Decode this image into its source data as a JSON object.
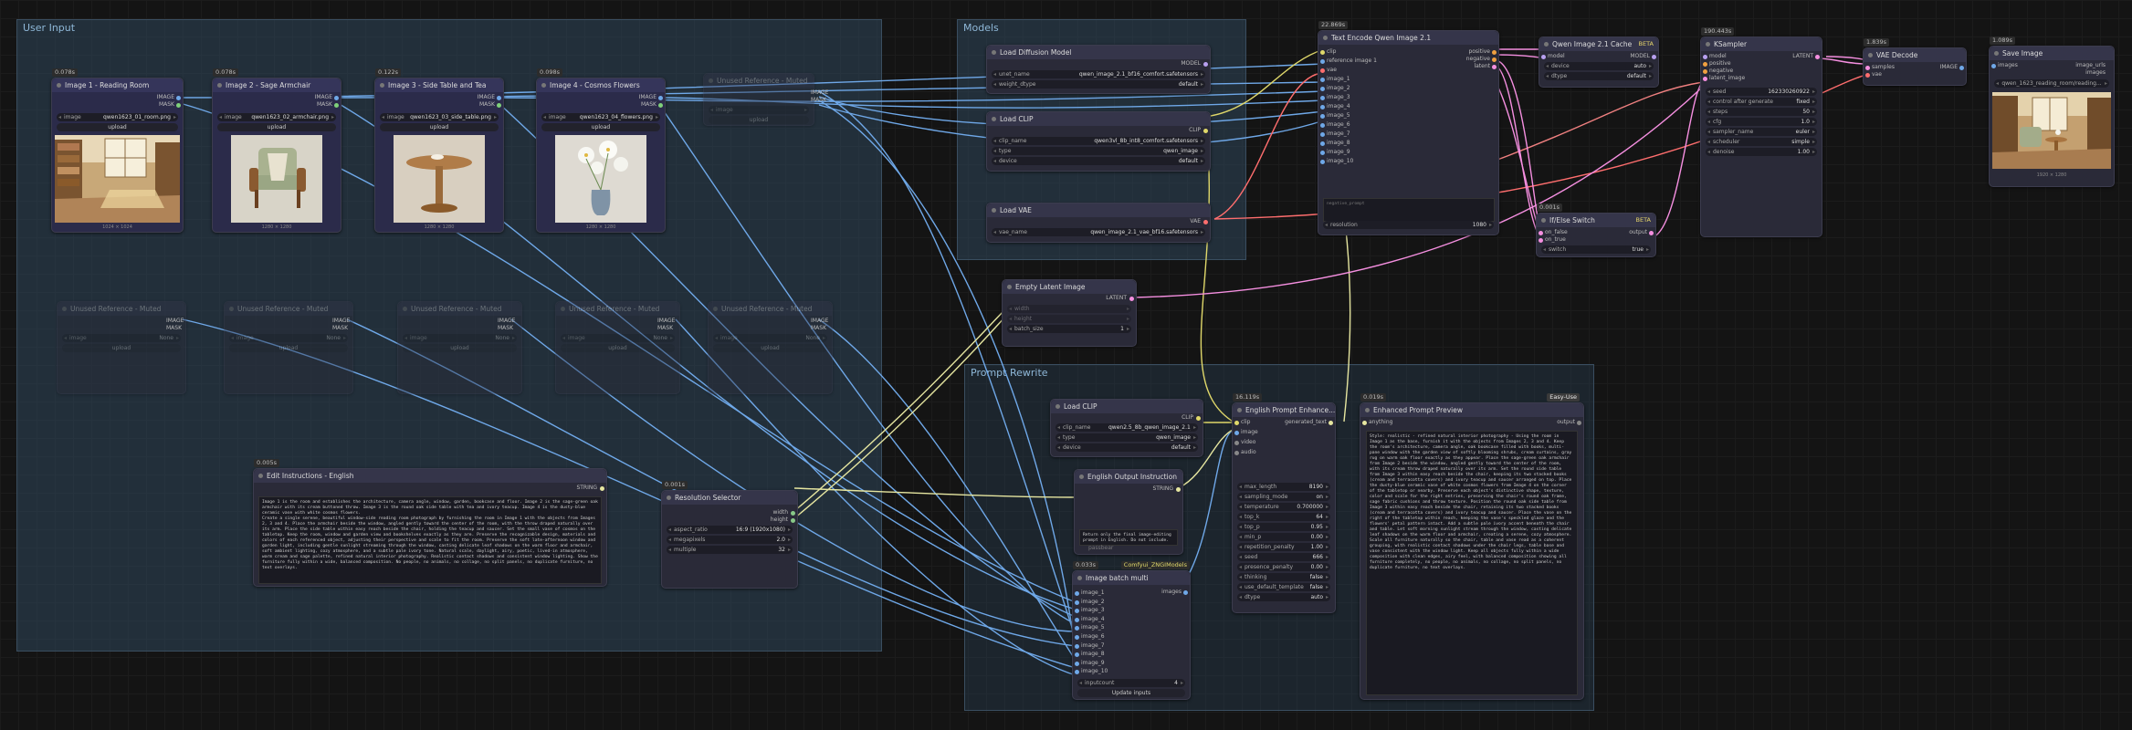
{
  "groups": {
    "user_input": "User Input",
    "models": "Models",
    "prompt_rewrite": "Prompt Rewrite"
  },
  "badges": {
    "img1": "0.078s",
    "img2": "0.078s",
    "img3": "0.122s",
    "img4": "0.098s",
    "edit": "0.005s",
    "res": "0.001s",
    "text_encode": "22.869s",
    "qwen_cache": "BETA",
    "ksampler": "190.443s",
    "vae_decode": "1.839s",
    "save": "1.089s",
    "if_else": "0.001s",
    "batch": "0.033s",
    "batch_tag": "Comfyui_ZNGIModels",
    "enhance": "16.119s",
    "preview": "0.019s",
    "preview_tag": "Easy-Use"
  },
  "image_nodes": [
    {
      "title": "Image 1 - Reading Room",
      "file": "qwen1623_01_room.png",
      "caption": "1024 × 1024"
    },
    {
      "title": "Image 2 - Sage Armchair",
      "file": "qwen1623_02_armchair.png",
      "caption": "1280 × 1280"
    },
    {
      "title": "Image 3 - Side Table and Tea",
      "file": "qwen1623_03_side_table.png",
      "caption": "1280 × 1280"
    },
    {
      "title": "Image 4 - Cosmos Flowers",
      "file": "qwen1623_04_flowers.png",
      "caption": "1280 × 1280"
    }
  ],
  "muted_nodes": [
    "Unused Reference - Muted",
    "Unused Reference - Muted",
    "Unused Reference - Muted",
    "Unused Reference - Muted",
    "Unused Reference - Muted",
    "Unused Reference - Muted"
  ],
  "labels": {
    "image": "IMAGE",
    "mask": "MASK",
    "image_w": "image",
    "upload": "upload",
    "none": "None"
  },
  "load_diffusion": {
    "title": "Load Diffusion Model",
    "out": "MODEL",
    "unet_name_k": "unet_name",
    "unet_name_v": "qwen_image_2.1_bf16_comfort.safetensors",
    "weight_dtype_k": "weight_dtype",
    "weight_dtype_v": "default"
  },
  "load_clip": {
    "title": "Load CLIP",
    "out": "CLIP",
    "clip_name_k": "clip_name",
    "clip_name_v": "qwen3vl_8b_int8_comfort.safetensors",
    "type_k": "type",
    "type_v": "qwen_image",
    "device_k": "device",
    "device_v": "default"
  },
  "load_vae": {
    "title": "Load VAE",
    "out": "VAE",
    "vae_name_k": "vae_name",
    "vae_name_v": "qwen_image_2.1_vae_bf16.safetensors"
  },
  "empty_latent": {
    "title": "Empty Latent Image",
    "out": "LATENT",
    "width": "width",
    "height": "height",
    "batch_k": "batch_size",
    "batch_v": "1"
  },
  "text_encode": {
    "title": "Text Encode Qwen Image 2.1",
    "inputs": [
      "clip",
      "reference image 1",
      "vae",
      "image_1",
      "image_2",
      "image_3",
      "image_4",
      "image_5",
      "image_6",
      "image_7",
      "image_8",
      "image_9",
      "image_10"
    ],
    "prompt_placeholder": "negative_prompt",
    "res_k": "resolution",
    "res_v": "1080",
    "outs": [
      "positive",
      "negative",
      "latent"
    ]
  },
  "qwen_cache": {
    "title": "Qwen Image 2.1 Cache",
    "in_model": "model",
    "out_model": "MODEL",
    "device_k": "device",
    "device_v": "auto",
    "dtype_k": "dtype",
    "dtype_v": "default"
  },
  "ksampler": {
    "title": "KSampler",
    "inputs": [
      "model",
      "positive",
      "negative",
      "latent_image"
    ],
    "out": "LATENT",
    "widgets": [
      [
        "seed",
        "162330260922"
      ],
      [
        "control after generate",
        "fixed"
      ],
      [
        "steps",
        "50"
      ],
      [
        "cfg",
        "1.0"
      ],
      [
        "sampler_name",
        "euler"
      ],
      [
        "scheduler",
        "simple"
      ],
      [
        "denoise",
        "1.00"
      ]
    ]
  },
  "vae_decode": {
    "title": "VAE Decode",
    "in1": "samples",
    "in2": "vae",
    "out": "IMAGE"
  },
  "save_image": {
    "title": "Save Image",
    "in": "images",
    "outs": [
      "image_urls",
      "images"
    ],
    "file": "qwen_1623_reading_room/reading...",
    "caption": "1920 × 1280"
  },
  "if_else": {
    "title": "If/Else Switch",
    "in1": "on_false",
    "in2": "on_true",
    "out": "output",
    "switch_k": "switch",
    "switch_v": "true"
  },
  "edit_instructions": {
    "title": "Edit Instructions - English",
    "out": "STRING",
    "text": "Image 1 is the room and establishes the architecture, camera angle, window, garden, bookcase and floor. Image 2 is the sage-green oak armchair with its cream buttoned throw. Image 3 is the round oak side table with tea and ivory teacup. Image 4 is the dusty-blue ceramic vase with white cosmos flowers.\nCreate a single serene, beautiful window-side reading room photograph by furnishing the room in Image 1 with the objects from Images 2, 3 and 4. Place the armchair beside the window, angled gently toward the center of the room, with the throw draped naturally over its arm. Place the side table within easy reach beside the chair, holding the teacup and saucer. Set the small vase of cosmos on the tabletop. Keep the room, window and garden view and bookshelves exactly as they are. Preserve the recognizable design, materials and colors of each referenced object, adjusting their perspective and scale to fit the room. Preserve the soft late-afternoon window and garden light, including gentle sunlight streaming through the window, casting delicate leaf shadows on the warm floor and armchair, soft ambient lighting, cozy atmosphere, and a subtle pale ivory tone. Natural scale, daylight, airy, poetic, lived-in atmosphere, warm cream and sage palette, refined natural interior photography. Realistic contact shadows and consistent window lighting. Show the furniture fully within a wide, balanced composition. No people, no animals, no collage, no split panels, no duplicate furniture, no text overlays."
  },
  "res_selector": {
    "title": "Resolution Selector",
    "outs": [
      "width",
      "height"
    ],
    "w": [
      [
        "aspect_ratio",
        "16:9 (1920x1080)"
      ],
      [
        "megapixels",
        "2.0"
      ],
      [
        "multiple",
        "32"
      ]
    ]
  },
  "load_clip2": {
    "title": "Load CLIP",
    "out": "CLIP",
    "w": [
      [
        "clip_name",
        "qwen2.5_8b_qwen_image_2.1_int8_(3).int8_comfort"
      ],
      [
        "type",
        "qwen_image"
      ],
      [
        "device",
        "default"
      ]
    ]
  },
  "english_out": {
    "title": "English Output Instruction",
    "out": "STRING",
    "text": "Return only the final image-editing prompt in English. Do not include.",
    "placeholder": "passbear"
  },
  "batch": {
    "title": "Image batch multi",
    "out": "images",
    "inputs": [
      "image_1",
      "image_2",
      "image_3",
      "image_4",
      "image_5",
      "image_6",
      "image_7",
      "image_8",
      "image_9",
      "image_10"
    ],
    "inputcount_k": "inputcount",
    "inputcount_v": "4",
    "update": "Update inputs"
  },
  "enhance": {
    "title": "English Prompt Enhance...",
    "inputs": [
      "clip",
      "image",
      "video",
      "audio"
    ],
    "out": "generated_text",
    "w": [
      [
        "max_length",
        "8190"
      ],
      [
        "sampling_mode",
        "on"
      ],
      [
        "temperature",
        "0.700000"
      ],
      [
        "top_k",
        "64"
      ],
      [
        "top_p",
        "0.95"
      ],
      [
        "min_p",
        "0.00"
      ],
      [
        "repetition_penalty",
        "1.00"
      ],
      [
        "seed",
        "666"
      ],
      [
        "presence_penalty",
        "0.00"
      ],
      [
        "thinking",
        "false"
      ],
      [
        "use_default_template",
        "false"
      ],
      [
        "dtype",
        "auto"
      ]
    ]
  },
  "preview": {
    "title": "Enhanced Prompt Preview",
    "in": "anything",
    "out": "output",
    "text": "Style: realistic - refined natural interior photography - Using the room in Image 1 as the base, furnish it with the objects from Images 2, 3 and 4. Keep the room's architecture, camera angle, oak bookcase filled with books, multi-pane window with the garden view of softly blooming shrubs, cream curtains, gray rug on warm oak floor exactly as they appear. Place the sage-green oak armchair from Image 2 beside the window, angled gently toward the center of the room, with its cream throw draped naturally over its arm. Set the round side table from Image 3 within easy reach beside the chair, keeping its two stacked books (cream and terracotta covers) and ivory teacup and saucer arranged on top. Place the dusty-blue ceramic vase of white cosmos flowers from Image 4 on the corner of the tabletop or nearby. Preserve each object's distinctive shape, texture, color and scale for the right entries, preserving the chair's round oak frame, sage fabric cushions and throw texture. Position the round oak side table from Image 3 within easy reach beside the chair, retaining its two stacked books (cream and terracotta covers) and ivory teacup and saucer. Place the vase on the right of the tabletop within reach, keeping the vase's speckled glaze and the flowers' petal pattern intact. Add a subtle pale ivory accent beneath the chair and table. Let soft morning sunlight stream through the window, casting delicate leaf shadows on the warm floor and armchair, creating a serene, cozy atmosphere. Scale all furniture naturally so the chair, table and vase read as a coherent grouping, with realistic contact shadows under the chair legs, table base and vase consistent with the window light. Keep all objects fully within a wide composition with clean edges, airy feel, with balanced composition showing all furniture completely, no people, no animals, no collage, no split panels, no duplicate furniture, no text overlays."
  }
}
